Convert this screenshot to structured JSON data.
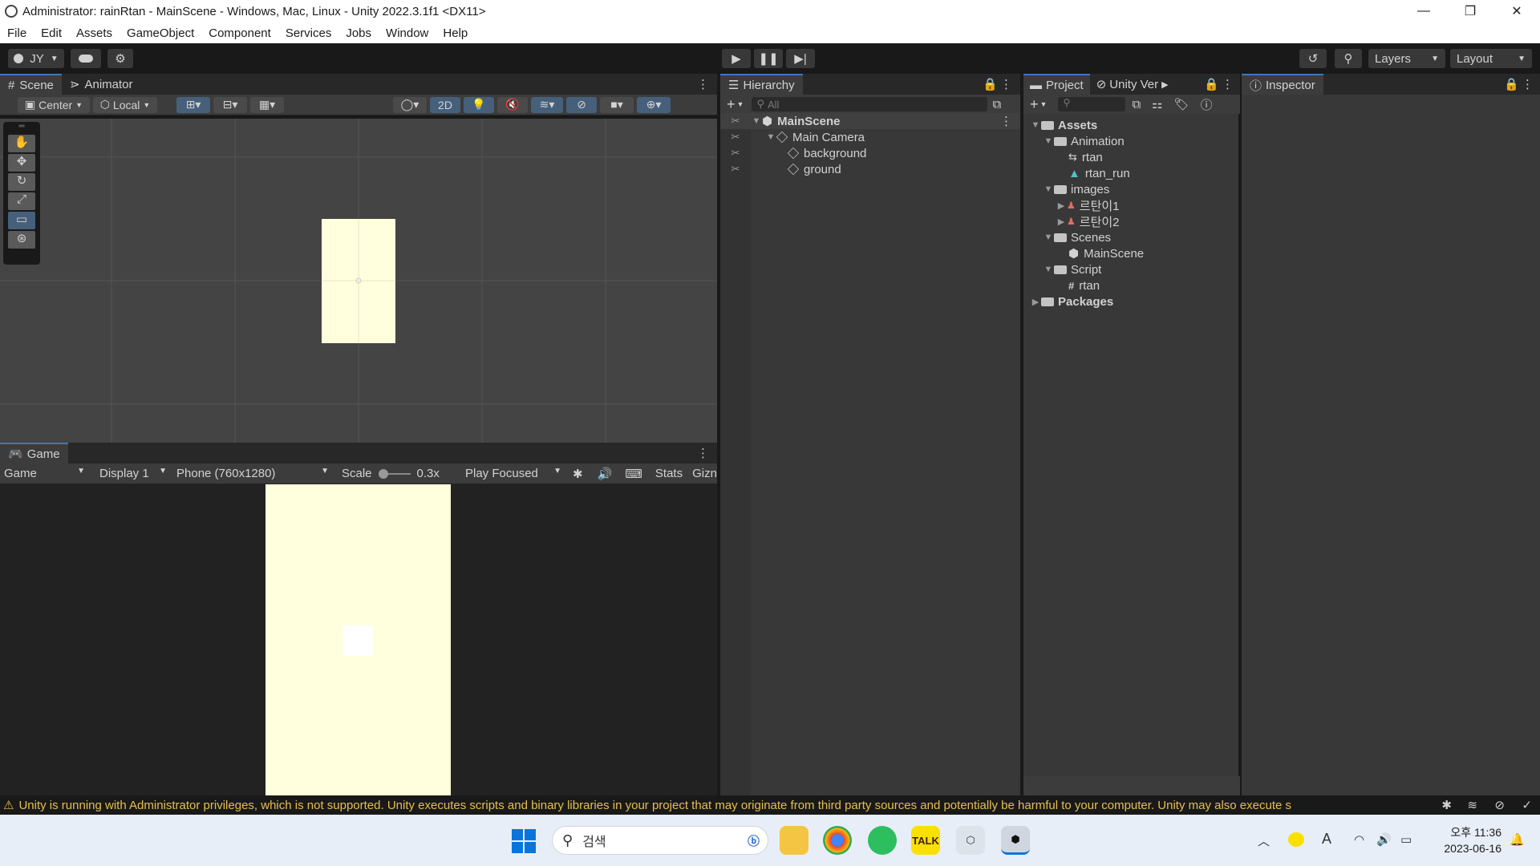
{
  "window": {
    "title": "Administrator: rainRtan - MainScene - Windows, Mac, Linux - Unity 2022.3.1f1 <DX11>",
    "minimize_glyph": "—",
    "restore_glyph": "❐",
    "close_glyph": "✕"
  },
  "menu": [
    "File",
    "Edit",
    "Assets",
    "GameObject",
    "Component",
    "Services",
    "Jobs",
    "Window",
    "Help"
  ],
  "toolbar": {
    "account": "JY",
    "layers_label": "Layers",
    "layout_label": "Layout"
  },
  "scene_panel": {
    "tabs": [
      "Scene",
      "Animator"
    ],
    "pivot_label": "Center",
    "space_label": "Local",
    "mode_2d": "2D"
  },
  "game_panel": {
    "tab": "Game",
    "view_select": "Game",
    "display_select": "Display 1",
    "resolution_select": "Phone (760x1280)",
    "scale_label": "Scale",
    "scale_value": "0.3x",
    "play_mode_select": "Play Focused",
    "stats_label": "Stats",
    "gizmos_label": "Gizn"
  },
  "hierarchy": {
    "title": "Hierarchy",
    "search_placeholder": "All",
    "scene": "MainScene",
    "items": [
      "Main Camera",
      "background",
      "ground"
    ]
  },
  "project": {
    "tab": "Project",
    "vcs_tab": "Unity Ver",
    "root": "Assets",
    "folders": [
      {
        "name": "Animation",
        "children": [
          "rtan",
          "rtan_run"
        ]
      },
      {
        "name": "images",
        "children": [
          "르탄이1",
          "르탄이2"
        ]
      },
      {
        "name": "Scenes",
        "children": [
          "MainScene"
        ]
      },
      {
        "name": "Script",
        "children": [
          "rtan"
        ]
      }
    ],
    "packages": "Packages"
  },
  "inspector": {
    "title": "Inspector"
  },
  "status": {
    "message": "Unity is running with Administrator privileges, which is not supported. Unity executes scripts and binary libraries in your project that may originate from third party sources and potentially be harmful to your computer. Unity may also execute s"
  },
  "taskbar": {
    "search_placeholder": "검색",
    "time": "오후 11:36",
    "date": "2023-06-16",
    "kakao_label": "TALK",
    "ime_label": "A"
  },
  "colors": {
    "accent": "#3a79bb",
    "canvas_cream": "#ffffdd",
    "warning": "#e4c04e"
  }
}
